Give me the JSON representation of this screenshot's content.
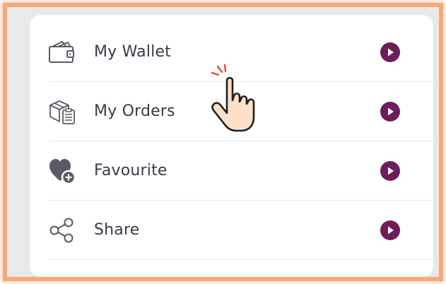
{
  "menu": {
    "items": [
      {
        "label": "My Wallet",
        "icon": "wallet-icon"
      },
      {
        "label": "My Orders",
        "icon": "orders-icon"
      },
      {
        "label": "Favourite",
        "icon": "favourite-heart-plus-icon"
      },
      {
        "label": "Share",
        "icon": "share-icon"
      }
    ],
    "arrow_icon": "play-circle-icon"
  },
  "overlay": {
    "cursor_icon": "hand-pointer-click-icon"
  },
  "colors": {
    "accent": "#6b1d5c",
    "text": "#3a3a48",
    "icon_stroke": "#5a5a66",
    "frame_border": "#f7a878",
    "card_background": "#ffffff",
    "page_background": "#e9e9e9"
  }
}
